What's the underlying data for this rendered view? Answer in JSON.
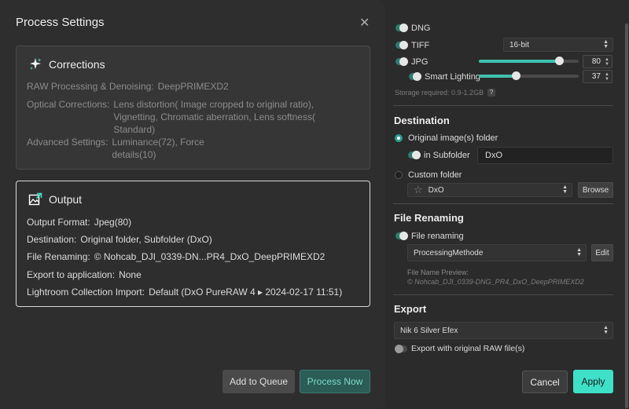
{
  "dialog": {
    "title": "Process Settings"
  },
  "corrections": {
    "heading": "Corrections",
    "rows": [
      {
        "label": "RAW Processing & Denoising:",
        "value": "DeepPRIMEXD2"
      },
      {
        "label": "Optical Corrections:",
        "value": "Lens distortion( Image cropped to original ratio), Vignetting, Chromatic aberration, Lens softness( Standard)"
      },
      {
        "label": "Advanced Settings:",
        "value": "Luminance(72), Force details(10)"
      }
    ]
  },
  "output": {
    "heading": "Output",
    "rows": [
      {
        "label": "Output Format:",
        "value": "Jpeg(80)"
      },
      {
        "label": "Destination:",
        "value": "Original folder, Subfolder (DxO)"
      },
      {
        "label": "File Renaming:",
        "value": "© Nohcab_DJI_0339-DN...PR4_DxO_DeepPRIMEXD2"
      },
      {
        "label": "Export to application:",
        "value": "None"
      },
      {
        "label": "Lightroom Collection Import:",
        "value": "Default (DxO PureRAW 4 ▸ 2024-02-17 11:51)"
      }
    ]
  },
  "buttons": {
    "add_to_queue": "Add to Queue",
    "process_now": "Process Now",
    "cancel": "Cancel",
    "apply": "Apply"
  },
  "format": {
    "dng_label": "DNG",
    "tiff_label": "TIFF",
    "tiff_bitdepth": "16-bit",
    "jpg_label": "JPG",
    "jpg_quality": "80",
    "jpg_quality_fraction": 0.8,
    "smart_lighting_label": "Smart Lighting",
    "smart_lighting_value": "37",
    "smart_lighting_fraction": 0.37,
    "storage_text": "Storage required: 0.9-1.2GB",
    "help_glyph": "?"
  },
  "destination": {
    "heading": "Destination",
    "original_folder_label": "Original image(s) folder",
    "subfolder_label": "in Subfolder",
    "subfolder_value": "DxO",
    "custom_folder_label": "Custom folder",
    "custom_folder_value": "DxO",
    "browse_label": "Browse"
  },
  "renaming": {
    "heading": "File Renaming",
    "toggle_label": "File renaming",
    "method_value": "ProcessingMethode",
    "edit_label": "Edit",
    "preview_label": "File Name Preview:",
    "preview_value": "© Nohcab_DJI_0339-DNG_PR4_DxO_DeepPRIMEXD2"
  },
  "export": {
    "heading": "Export",
    "app_value": "Nik 6 Silver Efex",
    "raw_toggle_label": "Export with original RAW file(s)"
  },
  "icons": {
    "close": "close-icon",
    "sparkle": "sparkle-icon",
    "export_image": "image-export-icon",
    "star": "star-icon",
    "updown": "up-down-arrows-icon"
  },
  "colors": {
    "accent": "#3ee0c8",
    "toggle_on": "#2d7a71"
  }
}
